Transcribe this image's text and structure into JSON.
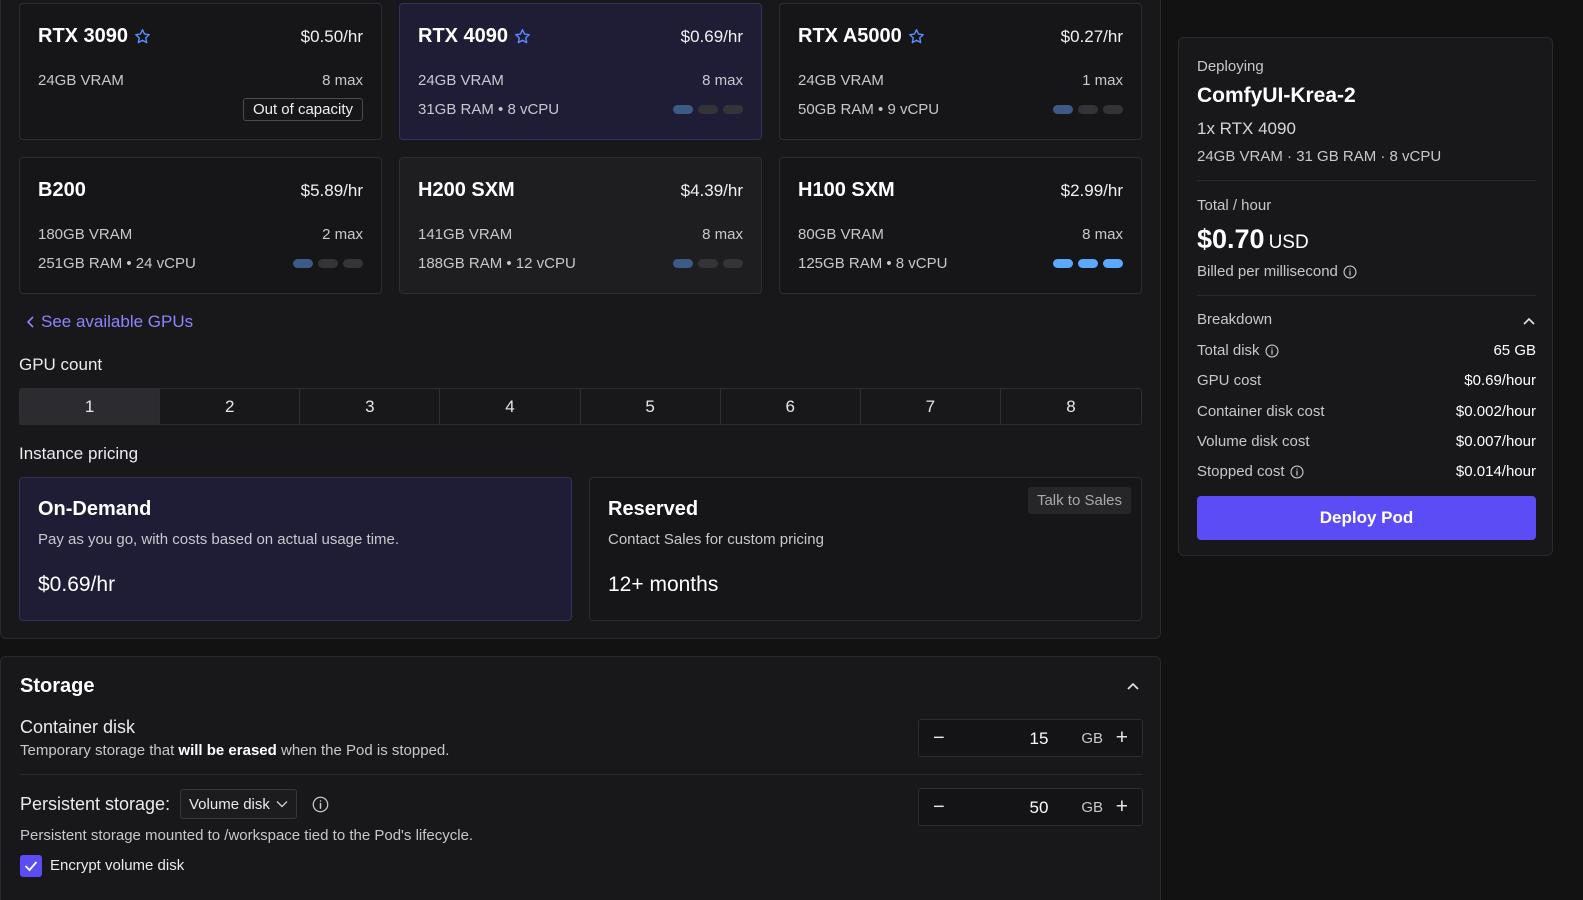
{
  "gpus": [
    {
      "name": "RTX 3090",
      "price": "$0.50/hr",
      "vram": "24GB VRAM",
      "max": "8 max",
      "ram": "",
      "badge": "Out of capacity"
    },
    {
      "name": "RTX 4090",
      "price": "$0.69/hr",
      "vram": "24GB VRAM",
      "max": "8 max",
      "ram": "31GB RAM • 8 vCPU",
      "badge": ""
    },
    {
      "name": "RTX A5000",
      "price": "$0.27/hr",
      "vram": "24GB VRAM",
      "max": "1 max",
      "ram": "50GB RAM • 9 vCPU",
      "badge": ""
    },
    {
      "name": "B200",
      "price": "$5.89/hr",
      "vram": "180GB VRAM",
      "max": "2 max",
      "ram": "251GB RAM • 24 vCPU",
      "badge": ""
    },
    {
      "name": "H200 SXM",
      "price": "$4.39/hr",
      "vram": "141GB VRAM",
      "max": "8 max",
      "ram": "188GB RAM • 12 vCPU",
      "badge": ""
    },
    {
      "name": "H100 SXM",
      "price": "$2.99/hr",
      "vram": "80GB VRAM",
      "max": "8 max",
      "ram": "125GB RAM • 8 vCPU",
      "badge": ""
    }
  ],
  "see_gpus_link": "See available GPUs",
  "gpu_count": {
    "label": "GPU count",
    "options": [
      "1",
      "2",
      "3",
      "4",
      "5",
      "6",
      "7",
      "8"
    ],
    "selected": "1"
  },
  "instance_pricing": {
    "label": "Instance pricing",
    "on_demand": {
      "title": "On-Demand",
      "desc": "Pay as you go, with costs based on actual usage time.",
      "price": "$0.69/hr"
    },
    "reserved": {
      "title": "Reserved",
      "desc": "Contact Sales for custom pricing",
      "price": "12+ months",
      "badge": "Talk to Sales"
    }
  },
  "storage": {
    "title": "Storage",
    "container_disk": {
      "label": "Container disk",
      "desc_pre": "Temporary storage that ",
      "desc_bold": "will be erased",
      "desc_post": " when the Pod is stopped.",
      "value": "15",
      "unit": "GB"
    },
    "persistent": {
      "label": "Persistent storage:",
      "select_value": "Volume disk",
      "desc": "Persistent storage mounted to /workspace tied to the Pod's lifecycle.",
      "value": "50",
      "unit": "GB",
      "encrypt_label": "Encrypt volume disk"
    }
  },
  "summary": {
    "deploying_label": "Deploying",
    "pod_name": "ComfyUI-Krea-2",
    "gpu_line": "1x RTX 4090",
    "specs_line": "24GB VRAM · 31 GB RAM · 8 vCPU",
    "total_label": "Total / hour",
    "total_value": "$0.70",
    "currency": "USD",
    "billed": "Billed per millisecond",
    "breakdown_label": "Breakdown",
    "rows": [
      {
        "label": "Total disk",
        "value": "65 GB"
      },
      {
        "label": "GPU cost",
        "value": "$0.69/hour"
      },
      {
        "label": "Container disk cost",
        "value": "$0.002/hour"
      },
      {
        "label": "Volume disk cost",
        "value": "$0.007/hour"
      },
      {
        "label": "Stopped cost",
        "value": "$0.014/hour"
      }
    ],
    "deploy_button": "Deploy Pod"
  },
  "colors": {
    "accent": "#5b4cf5",
    "link": "#8d84ff",
    "star": "#5a8cff",
    "bar_bright": "#5aa8ff"
  }
}
